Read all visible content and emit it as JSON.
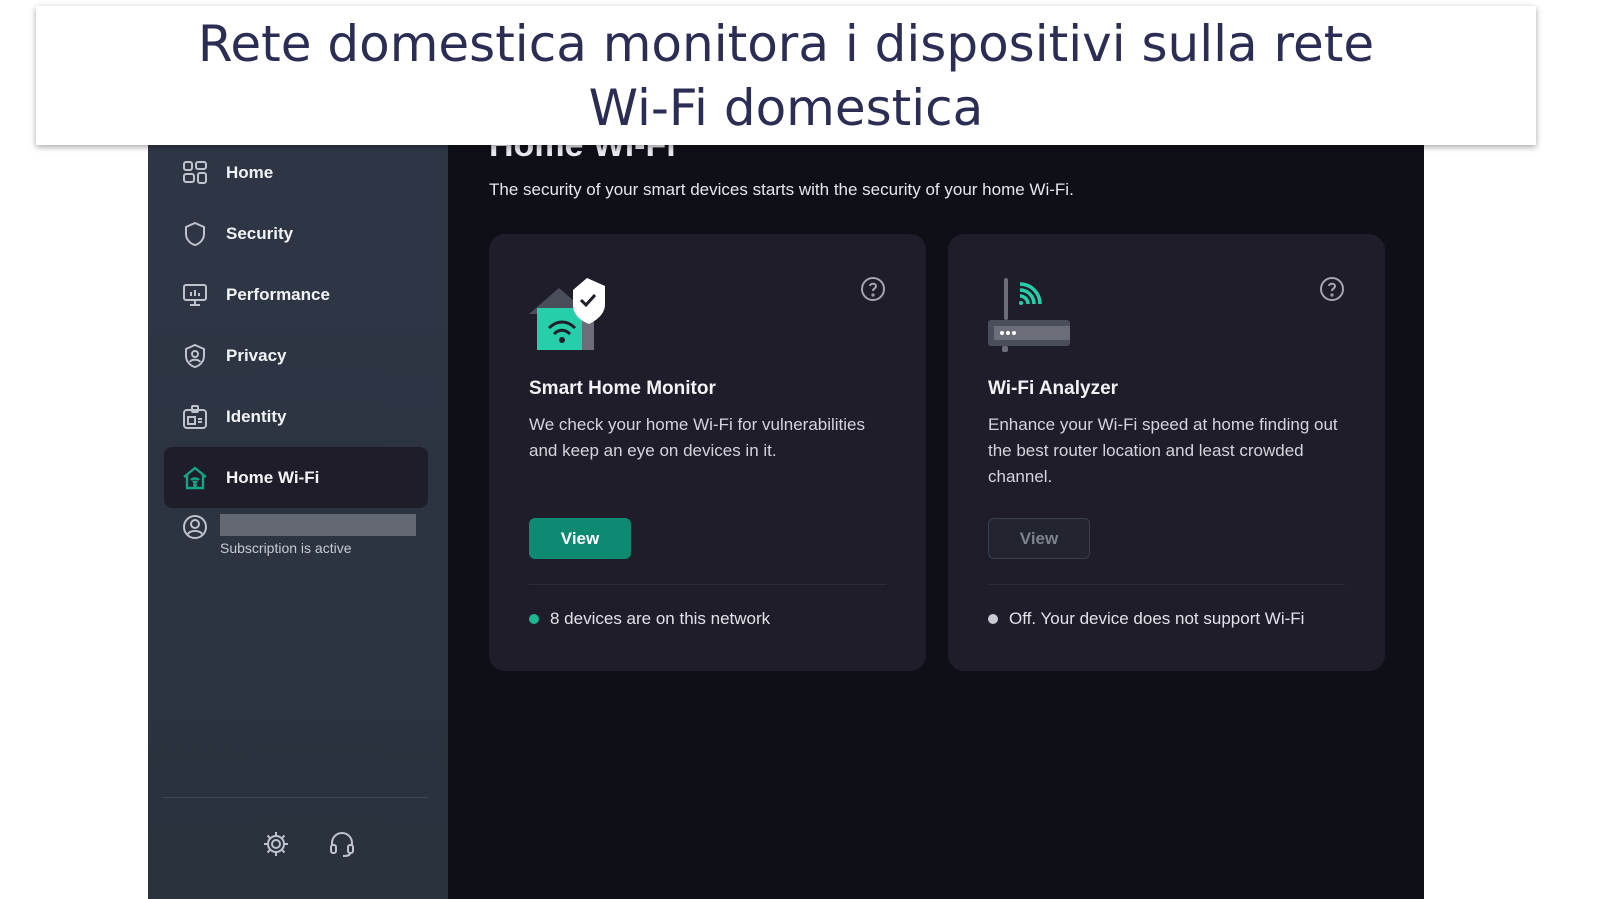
{
  "banner": {
    "line1": "Rete domestica monitora i dispositivi sulla rete",
    "line2": "Wi-Fi domestica"
  },
  "sidebar": {
    "items": [
      {
        "label": "Home",
        "icon": "grid-icon"
      },
      {
        "label": "Security",
        "icon": "shield-icon"
      },
      {
        "label": "Performance",
        "icon": "monitor-icon"
      },
      {
        "label": "Privacy",
        "icon": "privacy-icon"
      },
      {
        "label": "Identity",
        "icon": "id-card-icon"
      },
      {
        "label": "Home Wi-Fi",
        "icon": "home-wifi-icon",
        "active": true
      }
    ],
    "account": {
      "subscription": "Subscription is active"
    }
  },
  "main": {
    "title": "Home Wi-Fi",
    "description": "The security of your smart devices starts with the security of your home Wi-Fi.",
    "cards": [
      {
        "title": "Smart Home Monitor",
        "text": "We check your home Wi-Fi for vulnerabilities and keep an eye on devices in it.",
        "button": "View",
        "status": "8 devices are on this network",
        "status_color": "#1bb893",
        "enabled": true
      },
      {
        "title": "Wi-Fi Analyzer",
        "text": "Enhance your Wi-Fi speed at home finding out the best router location and least crowded channel.",
        "button": "View",
        "status": "Off. Your device does not support Wi-Fi",
        "status_color": "#c9cbd1",
        "enabled": false
      }
    ]
  },
  "colors": {
    "accent": "#0e8a73",
    "sidebar": "#2f3646",
    "main_bg": "#0f0f17",
    "card_bg": "#1e1d29"
  }
}
